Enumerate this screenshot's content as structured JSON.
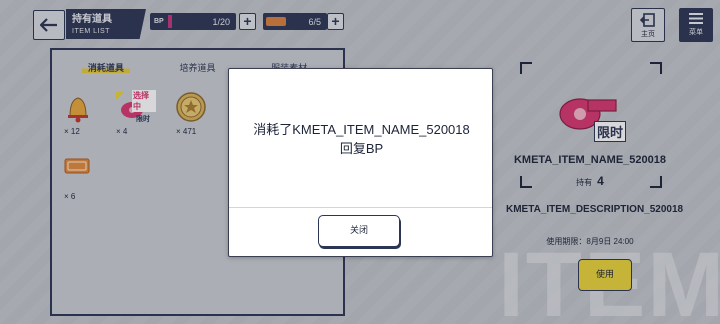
{
  "header": {
    "title": "持有道具",
    "subtitle": "ITEM LIST",
    "bp_tag": "BP",
    "bp_value": "1/20",
    "bp_fill": 0.05,
    "ticket_value": "6/5",
    "home_label": "主页",
    "menu_label": "菜单"
  },
  "tabs": [
    {
      "label": "消耗道具",
      "active": true
    },
    {
      "label": "培养道具",
      "active": false
    },
    {
      "label": "服装素材",
      "active": false
    }
  ],
  "items": [
    {
      "icon": "bell-icon",
      "count": "12"
    },
    {
      "icon": "whistle-icon",
      "count": "4",
      "badge": "选择中",
      "tag": "限时"
    },
    {
      "icon": "medal-coin-icon",
      "count": "471"
    },
    {
      "icon": "ticket-icon",
      "count": "6"
    }
  ],
  "detail": {
    "item_name": "KMETA_ITEM_NAME_520018",
    "owned_label": "持有",
    "owned_count": "4",
    "description": "KMETA_ITEM_DESCRIPTION_520018",
    "expire": "使用期限：8月9日 24:00",
    "limited_tag": "限时",
    "use_label": "使用"
  },
  "watermark": "ITEM",
  "dialog": {
    "message": "消耗了KMETA_ITEM_NAME_520018回复BP",
    "close_label": "关闭"
  },
  "colors": {
    "navy": "#2c3554",
    "accent_yellow": "#e8d33a",
    "whistle_pink": "#d6366f"
  }
}
